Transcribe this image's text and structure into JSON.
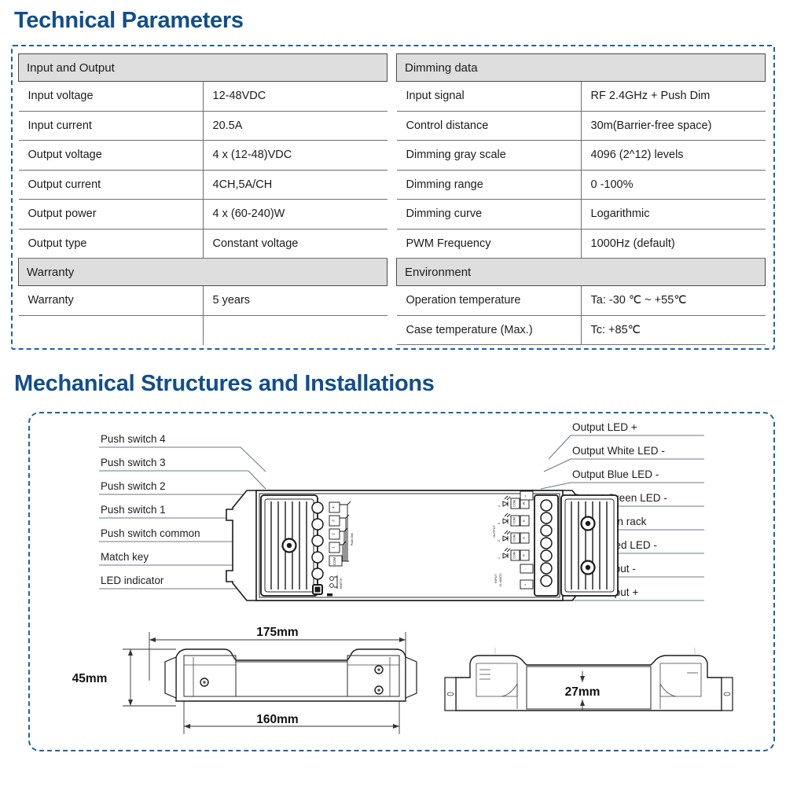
{
  "sections": {
    "technical_heading": "Technical Parameters",
    "mechanical_heading": "Mechanical Structures and Installations"
  },
  "colors": {
    "heading_blue": "#114E8C",
    "dashed_border_blue": "#1B64A5",
    "table_group_gray": "#DEDEDE",
    "table_rule": "#6F6F6F"
  },
  "spec_tables": {
    "left": [
      {
        "type": "group",
        "label": "Input and Output"
      },
      {
        "type": "row",
        "key": "Input voltage",
        "value": "12-48VDC"
      },
      {
        "type": "row",
        "key": "Input current",
        "value": "20.5A"
      },
      {
        "type": "row",
        "key": "Output voltage",
        "value": "4 x (12-48)VDC"
      },
      {
        "type": "row",
        "key": "Output current",
        "value": "4CH,5A/CH"
      },
      {
        "type": "row",
        "key": "Output power",
        "value": "4 x (60-240)W"
      },
      {
        "type": "row",
        "key": "Output type",
        "value": "Constant voltage"
      },
      {
        "type": "group",
        "label": "Warranty"
      },
      {
        "type": "row",
        "key": "Warranty",
        "value": "5 years"
      },
      {
        "type": "blank",
        "key": "",
        "value": ""
      }
    ],
    "right": [
      {
        "type": "group",
        "label": "Dimming data"
      },
      {
        "type": "row",
        "key": "Input signal",
        "value": "RF 2.4GHz + Push Dim"
      },
      {
        "type": "row",
        "key": "Control distance",
        "value": "30m(Barrier-free space)"
      },
      {
        "type": "row",
        "key": "Dimming gray scale",
        "value": "4096 (2^12) levels"
      },
      {
        "type": "row",
        "key": "Dimming range",
        "value": "0 -100%"
      },
      {
        "type": "row",
        "key": "Dimming curve",
        "value": "Logarithmic"
      },
      {
        "type": "row",
        "key": "PWM Frequency",
        "value": "1000Hz (default)"
      },
      {
        "type": "group",
        "label": "Environment"
      },
      {
        "type": "row",
        "key": "Operation temperature",
        "value": "Ta: -30 ℃ ~ +55℃"
      },
      {
        "type": "row",
        "key": "Case temperature (Max.)",
        "value": "Tc: +85℃"
      }
    ]
  },
  "diagram": {
    "left_labels": [
      "Push switch 4",
      "Push switch 3",
      "Push switch 2",
      "Push switch 1",
      "Push switch common",
      "Match key",
      "LED indicator"
    ],
    "right_labels": [
      "Output LED +",
      "Output White LED -",
      "Output Blue LED -",
      "Output Green LED -",
      "Installation rack",
      "Output Red LED -",
      "Power Input -",
      "Power Input +"
    ],
    "device_silkscreen": {
      "push_dim": "Push Dim",
      "match": "MATCH",
      "output": "OUTPUT",
      "input": "INPUT",
      "input_voltage": "12-48VDC",
      "push_terminals": [
        "4",
        "3",
        "2",
        "1",
        "COM"
      ],
      "channel_rows": [
        {
          "num": "4",
          "pair": [
            "COM",
            "W"
          ]
        },
        {
          "num": "3",
          "pair": [
            "COM",
            "B"
          ]
        },
        {
          "num": "2",
          "pair": [
            "COM",
            "G"
          ]
        },
        {
          "num": "1",
          "pair": [
            "COM",
            "R"
          ]
        }
      ],
      "power_terminals": [
        "+",
        "-",
        "+"
      ]
    },
    "dimensions": {
      "length_outer": "175mm",
      "length_inner": "160mm",
      "height": "45mm",
      "depth": "27mm"
    }
  }
}
